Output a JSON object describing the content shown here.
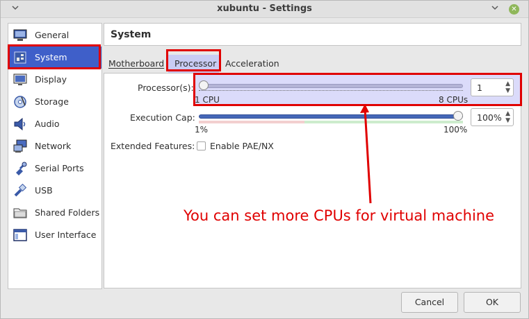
{
  "window": {
    "title": "xubuntu - Settings"
  },
  "sidebar": {
    "items": [
      {
        "label": "General",
        "icon": "monitor-icon"
      },
      {
        "label": "System",
        "icon": "system-board-icon",
        "selected": true
      },
      {
        "label": "Display",
        "icon": "display-icon"
      },
      {
        "label": "Storage",
        "icon": "storage-disc-icon"
      },
      {
        "label": "Audio",
        "icon": "speaker-icon"
      },
      {
        "label": "Network",
        "icon": "network-icon"
      },
      {
        "label": "Serial Ports",
        "icon": "serial-port-icon"
      },
      {
        "label": "USB",
        "icon": "usb-icon"
      },
      {
        "label": "Shared Folders",
        "icon": "folder-icon"
      },
      {
        "label": "User Interface",
        "icon": "window-icon"
      }
    ]
  },
  "header": {
    "title": "System"
  },
  "tabs": [
    {
      "label": "Motherboard",
      "active": false
    },
    {
      "label": "Processor",
      "active": true
    },
    {
      "label": "Acceleration",
      "active": false
    }
  ],
  "processor": {
    "label": "Processor(s):",
    "min_label": "1 CPU",
    "max_label": "8 CPUs",
    "value": "1",
    "min": 1,
    "max": 8
  },
  "execution_cap": {
    "label": "Execution Cap:",
    "min_label": "1%",
    "max_label": "100%",
    "value": "100%",
    "level": 1.0
  },
  "extended_features": {
    "label": "Extended Features:",
    "checkbox_label": "Enable PAE/NX",
    "checked": false
  },
  "annotation": {
    "text": "You can set more CPUs for virtual machine",
    "color": "#e00000"
  },
  "buttons": {
    "cancel": "Cancel",
    "ok": "OK"
  },
  "colors": {
    "accent": "#3f5fc9",
    "highlight_red": "#e00000",
    "tab_active": "#c9ccf4"
  }
}
